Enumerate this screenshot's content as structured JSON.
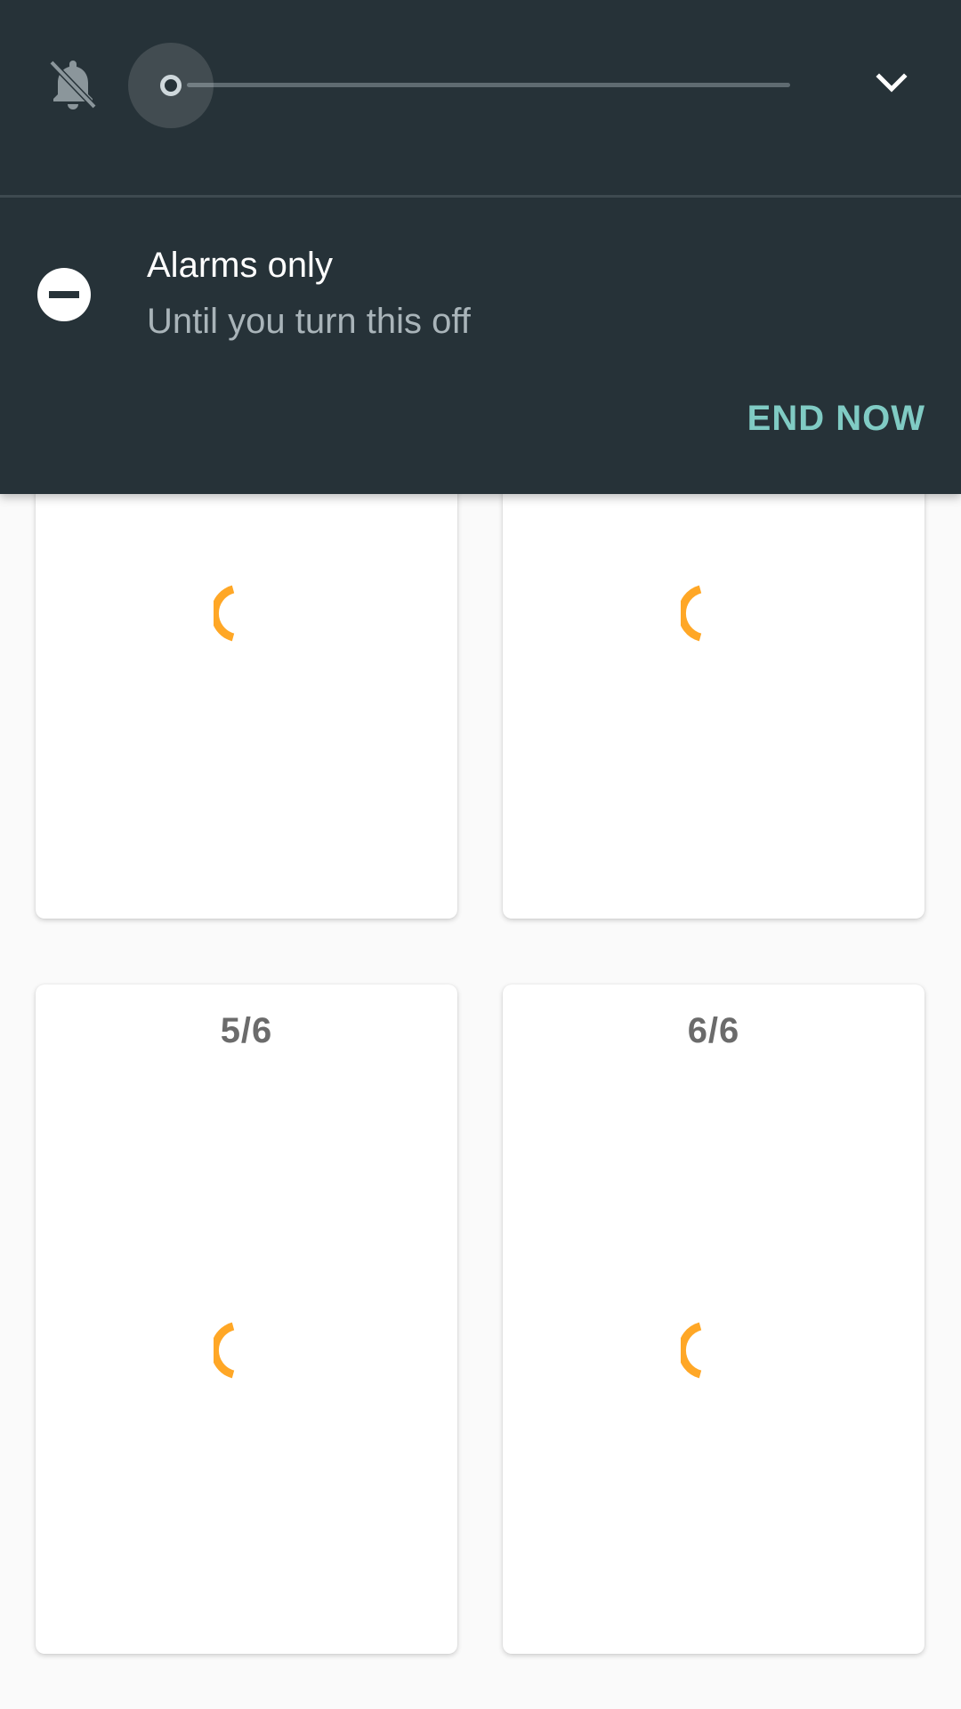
{
  "volume_panel": {
    "ringer_icon": "bell-off-icon",
    "expand_icon": "chevron-down-icon",
    "slider_level": 0
  },
  "dnd": {
    "icon": "do-not-disturb-icon",
    "title": "Alarms only",
    "subtitle": "Until you turn this off",
    "end_button": "END NOW"
  },
  "cards": [
    {
      "label": ""
    },
    {
      "label": ""
    },
    {
      "label": "5/6"
    },
    {
      "label": "6/6"
    }
  ],
  "colors": {
    "panel_background": "#263238",
    "accent": "#80cbc4",
    "spinner": "#ffa726"
  }
}
